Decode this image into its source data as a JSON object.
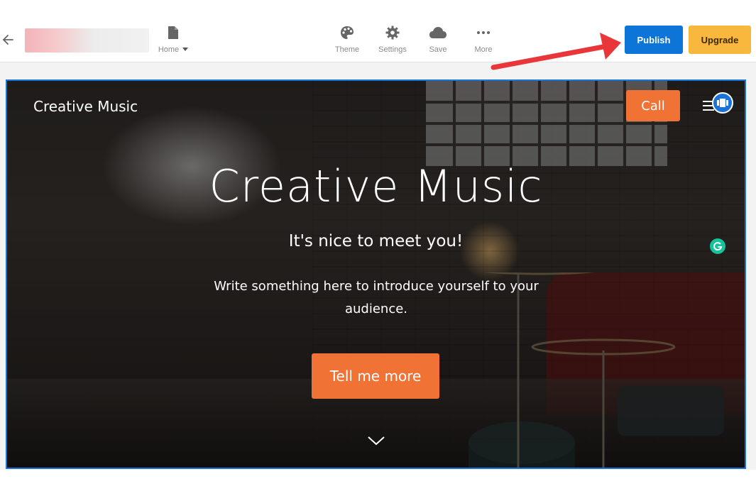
{
  "toolbar": {
    "home_label": "Home",
    "theme_label": "Theme",
    "settings_label": "Settings",
    "save_label": "Save",
    "more_label": "More",
    "publish_label": "Publish",
    "upgrade_label": "Upgrade"
  },
  "site": {
    "brand": "Creative Music",
    "call_label": "Call",
    "hero_title": "Creative Music",
    "hero_subtitle": "It's nice to meet you!",
    "hero_text": "Write something here to introduce yourself to your audience.",
    "cta_label": "Tell me more"
  },
  "colors": {
    "publish": "#0d75d8",
    "upgrade": "#f8b83d",
    "accent": "#f07235",
    "selection": "#1a73d9",
    "arrow": "#e8363a"
  },
  "icons": {
    "back": "arrow-left-icon",
    "home": "page-icon",
    "theme": "palette-icon",
    "settings": "gear-icon",
    "save": "cloud-icon",
    "more": "dots-icon"
  }
}
